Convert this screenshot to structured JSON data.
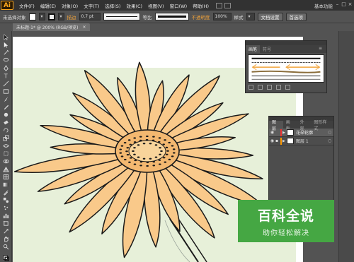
{
  "app": {
    "logo": "Ai",
    "workspace": "基本功能"
  },
  "menu": [
    "文件(F)",
    "编辑(E)",
    "对象(O)",
    "文字(T)",
    "选择(S)",
    "效果(C)",
    "视图(V)",
    "窗口(W)",
    "帮助(H)"
  ],
  "control_bar": {
    "selection": "未选择对象",
    "stroke_label": "描边",
    "stroke_weight": "0.7 pt",
    "profile_label": "等比",
    "opacity_label": "不透明度",
    "opacity_value": "100%",
    "style_label": "样式",
    "doc_setup": "文档设置",
    "preferences": "首选项"
  },
  "document_tab": {
    "title": "未标题-1* @ 200% (RGB/预览)",
    "close": "×"
  },
  "brushes_panel": {
    "tabs": [
      "画笔",
      "符号"
    ],
    "active_tab": 0
  },
  "layers_panel": {
    "tabs": [
      "图层",
      "画板",
      "外观",
      "图形样式"
    ],
    "active_tab": 0,
    "layers": [
      {
        "name": "花朵轮廓",
        "color": "#e33333",
        "selected": true,
        "locked": false
      },
      {
        "name": "图层 1",
        "color": "#ff9900",
        "selected": false,
        "locked": true
      }
    ]
  },
  "watermark": {
    "title": "百科全说",
    "subtitle": "助你轻松解决"
  },
  "colors": {
    "flower_fill": "#f9c98a",
    "outline": "#1a1a1a",
    "bg_green": "#e7f0d9",
    "brand_green": "#45a743"
  }
}
